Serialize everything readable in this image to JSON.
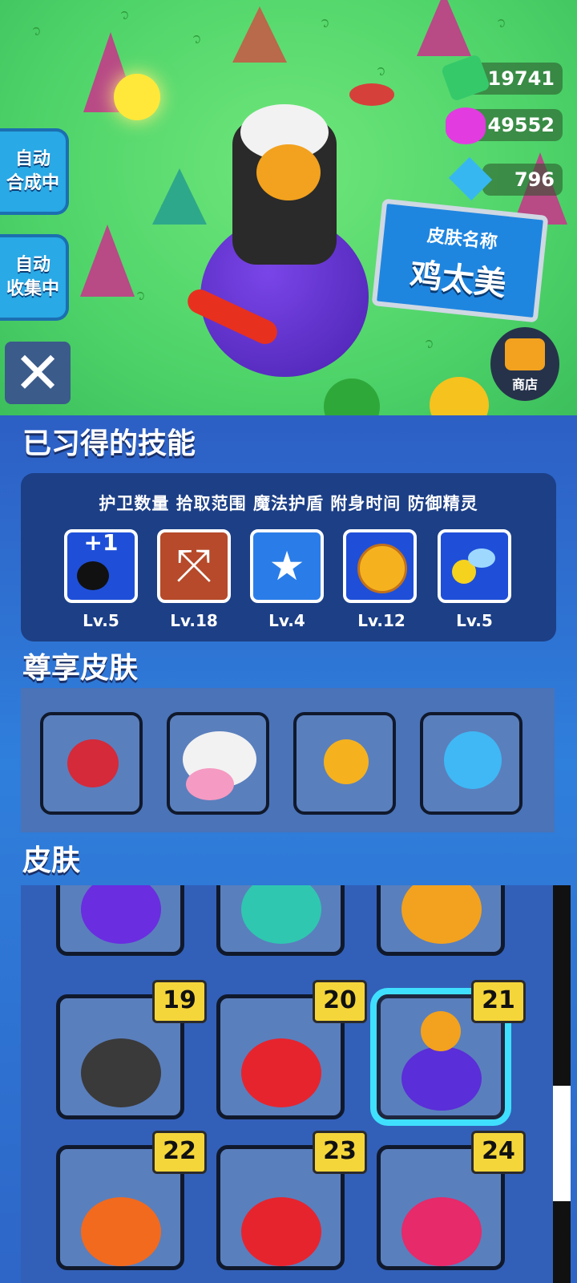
{
  "resources": [
    {
      "name": "cash",
      "value": "19741",
      "icon": "cash-icon",
      "color": "#35c96a"
    },
    {
      "name": "gem",
      "value": "49552",
      "icon": "gem-icon",
      "color": "#e23be0"
    },
    {
      "name": "crystal",
      "value": "796",
      "icon": "crystal-icon",
      "color": "#37b7f0"
    }
  ],
  "side_buttons": {
    "auto_merge": "自动\n合成中",
    "auto_collect": "自动\n收集中"
  },
  "sign": {
    "line1": "皮肤名称",
    "line2": "鸡太美"
  },
  "shop": {
    "label": "商店"
  },
  "skills_section": {
    "title": "已习得的技能",
    "names": "护卫数量 拾取范围 魔法护盾 附身时间 防御精灵",
    "skills": [
      {
        "icon": "bomb-sword-icon",
        "badge": "+1",
        "level": "Lv.5",
        "color": "#1f4fd8"
      },
      {
        "icon": "expand-arrows-icon",
        "level": "Lv.18",
        "color": "#b64a2a"
      },
      {
        "icon": "shield-star-icon",
        "level": "Lv.4",
        "color": "#2a7de8"
      },
      {
        "icon": "stopwatch-icon",
        "level": "Lv.12",
        "color": "#1f4fd8"
      },
      {
        "icon": "spirit-wings-icon",
        "level": "Lv.5",
        "color": "#1f4fd8"
      }
    ]
  },
  "premium_section": {
    "title": "尊享皮肤",
    "items": [
      "dragon",
      "cow",
      "drone",
      "octopus"
    ]
  },
  "skins_section": {
    "title": "皮肤",
    "items": [
      {
        "name": "purple-pumpkin",
        "color": "#6a2de0",
        "badge": ""
      },
      {
        "name": "teal-witch",
        "color": "#2fc7b0",
        "badge": ""
      },
      {
        "name": "orange-witch",
        "color": "#f2a21e",
        "badge": ""
      },
      {
        "name": "wizard-bomb",
        "color": "#3a3a3a",
        "badge": "19"
      },
      {
        "name": "knight-red",
        "color": "#e6242e",
        "badge": "20"
      },
      {
        "name": "chicken-purple",
        "color": "#5a2ed8",
        "badge": "21",
        "selected": true
      },
      {
        "name": "unicorn",
        "color": "#f26a1e",
        "badge": "22"
      },
      {
        "name": "watermelon",
        "color": "#e6242e",
        "badge": "23"
      },
      {
        "name": "cake",
        "color": "#e62a6a",
        "badge": "24"
      }
    ]
  }
}
